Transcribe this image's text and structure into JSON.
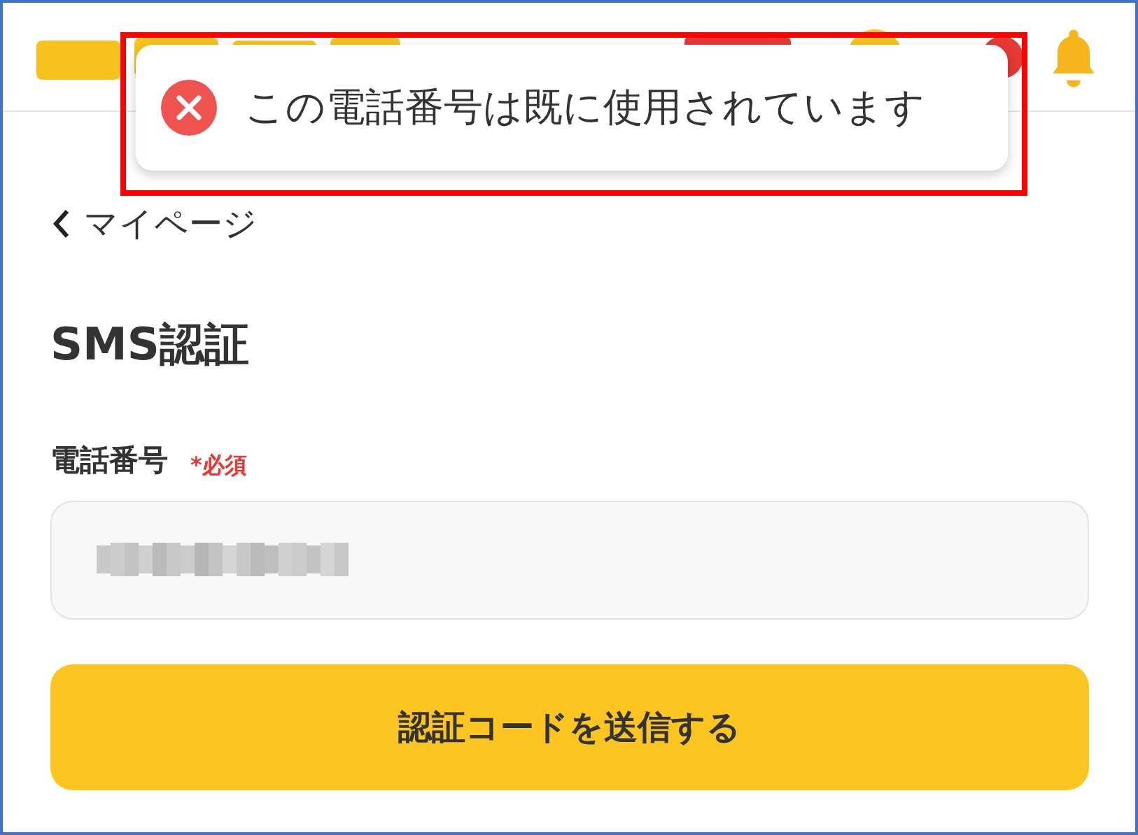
{
  "toast": {
    "kind": "error",
    "message": "この電話番号は既に使用されています",
    "highlighted": true
  },
  "back_link": {
    "label": "マイページ"
  },
  "title": "SMS認証",
  "phone_field": {
    "label": "電話番号",
    "required_label": "*必須",
    "redacted": true
  },
  "submit_button": {
    "label": "認証コードを送信する"
  }
}
